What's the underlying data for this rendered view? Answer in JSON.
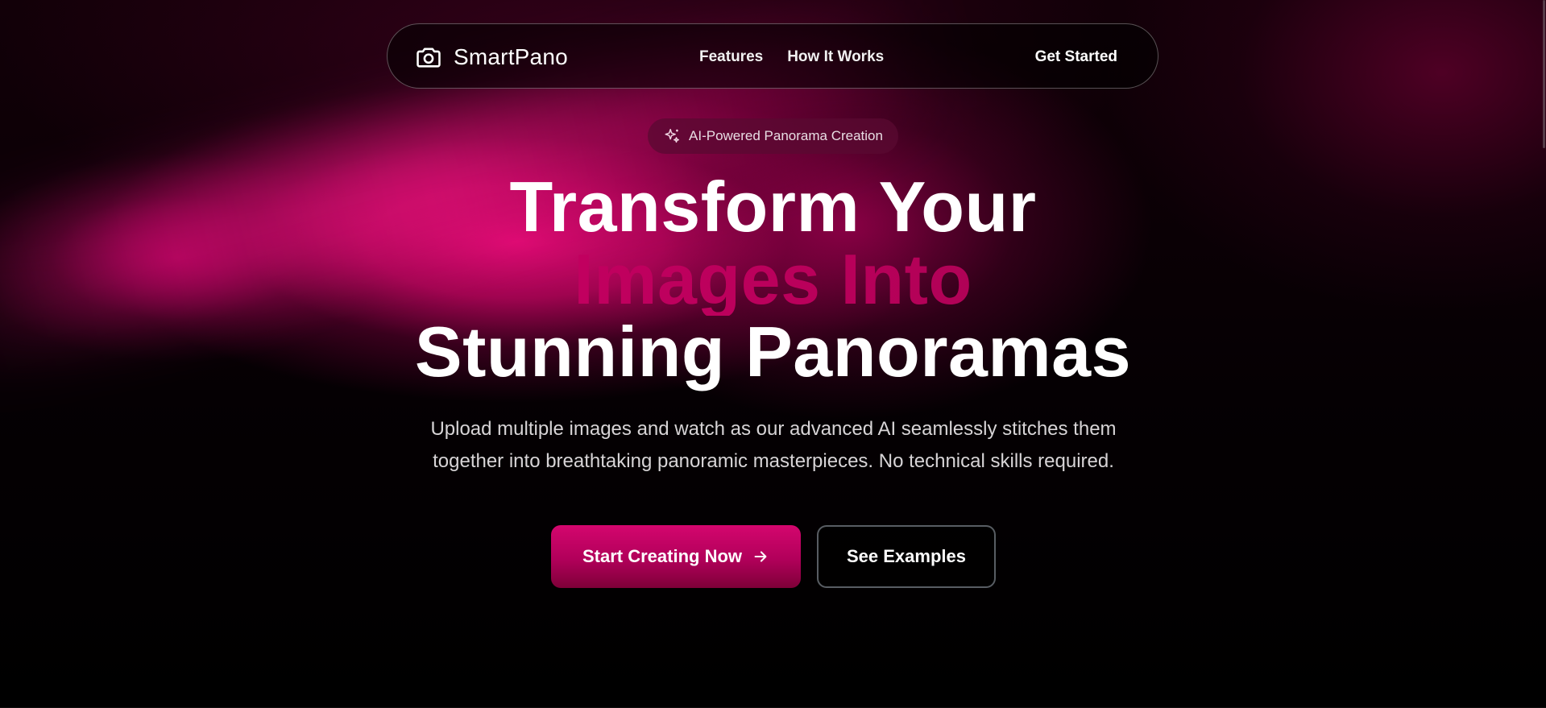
{
  "nav": {
    "brand_name": "SmartPano",
    "brand_icon": "camera-icon",
    "links": [
      {
        "label": "Features"
      },
      {
        "label": "How It Works"
      }
    ],
    "cta_label": "Get Started"
  },
  "hero": {
    "badge_icon": "sparkles-icon",
    "badge_text": "AI-Powered Panorama Creation",
    "headline_line1": "Transform Your",
    "headline_line2": "Images Into",
    "headline_line3": "Stunning Panoramas",
    "subtitle_line1": "Upload multiple images and watch as our advanced AI seamlessly stitches them",
    "subtitle_line2": "together into breathtaking panoramic masterpieces. No technical skills required.",
    "primary_button_label": "Start Creating Now",
    "primary_button_icon": "arrow-right-icon",
    "secondary_button_label": "See Examples"
  },
  "colors": {
    "accent": "#d4006a",
    "accent_dark": "#8a0a45",
    "background": "#000000",
    "text": "#ffffff"
  }
}
